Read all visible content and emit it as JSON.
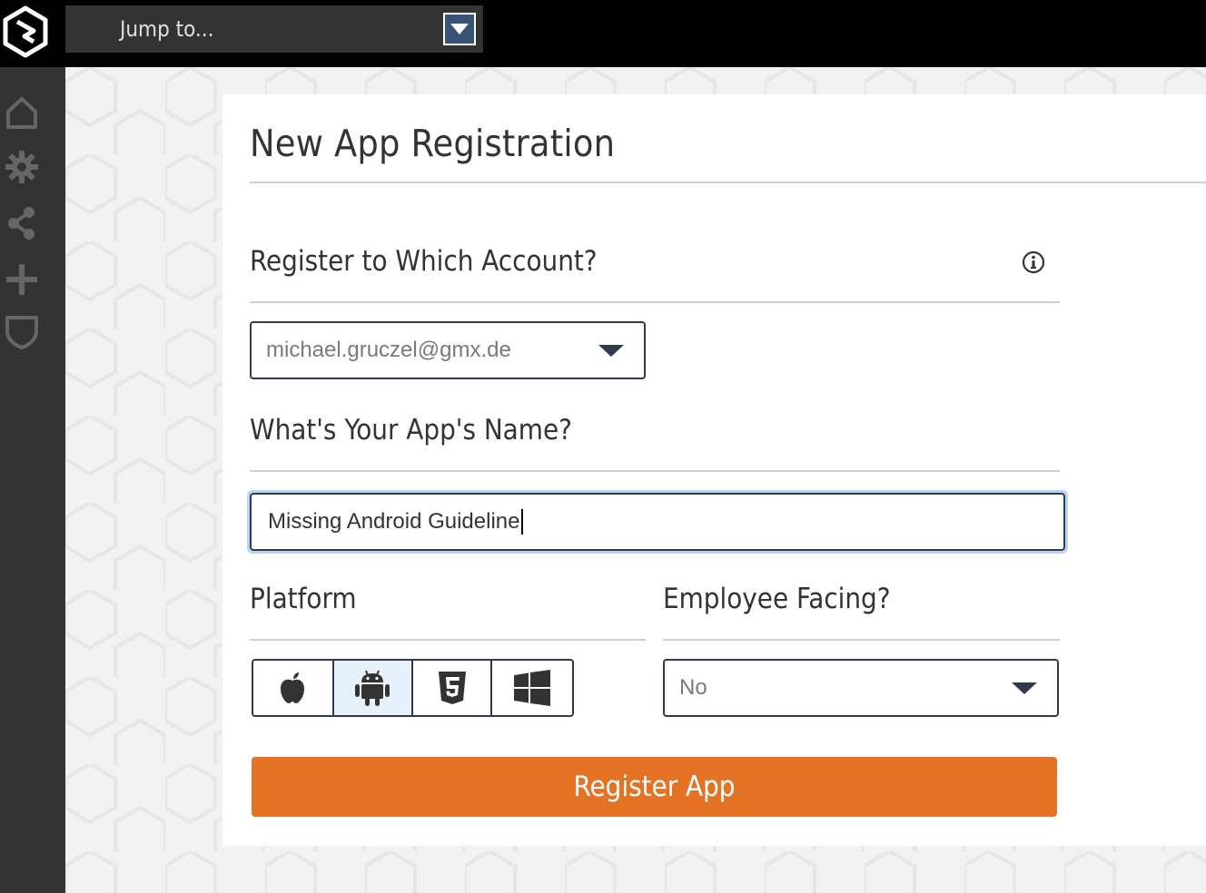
{
  "topbar": {
    "logo_icon": "app-logo",
    "jump_placeholder": "Jump to...",
    "jump_dropdown_icon": "chevron-down-icon"
  },
  "sidebar": {
    "items": [
      {
        "icon": "home-icon"
      },
      {
        "icon": "gear-icon"
      },
      {
        "icon": "share-icon"
      },
      {
        "icon": "plus-icon"
      },
      {
        "icon": "shield-icon"
      }
    ]
  },
  "form": {
    "title": "New App Registration",
    "account": {
      "label": "Register to Which Account?",
      "info_icon": "info-icon",
      "selected": "michael.gruczel@gmx.de"
    },
    "app_name": {
      "label": "What's Your App's Name?",
      "value": "Missing Android Guideline"
    },
    "platform": {
      "label": "Platform",
      "options": [
        {
          "icon": "apple-icon"
        },
        {
          "icon": "android-icon",
          "selected": true
        },
        {
          "icon": "html5-icon"
        },
        {
          "icon": "windows-icon"
        }
      ]
    },
    "employee_facing": {
      "label": "Employee Facing?",
      "selected": "No"
    },
    "submit_label": "Register App"
  },
  "colors": {
    "topbar": "#000000",
    "sidebar": "#333333",
    "accent": "#e57325",
    "border": "#2f3a4a",
    "focus": "#b8d6f3",
    "selected_segment": "#e6f1fb"
  }
}
